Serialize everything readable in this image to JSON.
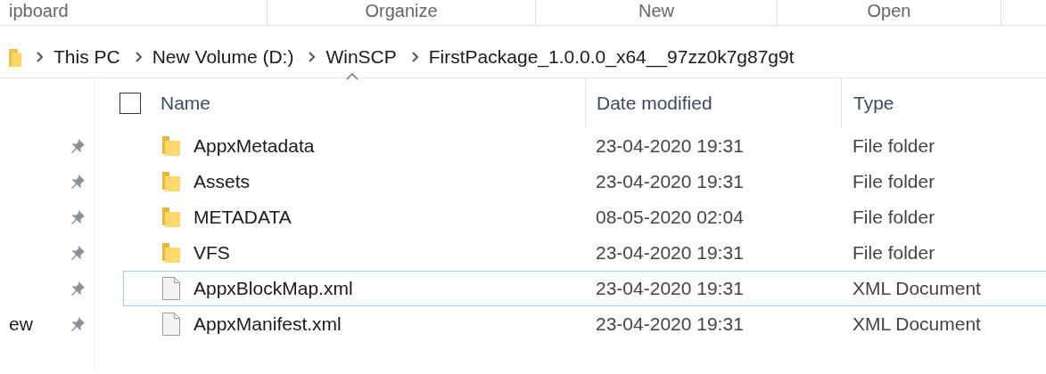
{
  "ribbon_groups": [
    "ipboard",
    "Organize",
    "New",
    "Open"
  ],
  "breadcrumb": [
    "This PC",
    "New Volume (D:)",
    "WinSCP",
    "FirstPackage_1.0.0.0_x64__97zz0k7g87g9t"
  ],
  "sidebar": {
    "items": [
      {
        "pinned": true
      },
      {
        "pinned": true
      },
      {
        "pinned": true
      },
      {
        "pinned": true
      },
      {
        "pinned": true
      },
      {
        "label": "ew",
        "pinned": true
      }
    ]
  },
  "table": {
    "select_all_checked": false,
    "columns": [
      "Name",
      "Date modified",
      "Type"
    ],
    "rows": [
      {
        "kind": "folder",
        "name": "AppxMetadata",
        "date": "23-04-2020 19:31",
        "type": "File folder",
        "selected": false
      },
      {
        "kind": "folder",
        "name": "Assets",
        "date": "23-04-2020 19:31",
        "type": "File folder",
        "selected": false
      },
      {
        "kind": "folder",
        "name": "METADATA",
        "date": "08-05-2020 02:04",
        "type": "File folder",
        "selected": false
      },
      {
        "kind": "folder",
        "name": "VFS",
        "date": "23-04-2020 19:31",
        "type": "File folder",
        "selected": false
      },
      {
        "kind": "file",
        "name": "AppxBlockMap.xml",
        "date": "23-04-2020 19:31",
        "type": "XML Document",
        "selected": true
      },
      {
        "kind": "file",
        "name": "AppxManifest.xml",
        "date": "23-04-2020 19:31",
        "type": "XML Document",
        "selected": false
      }
    ]
  }
}
